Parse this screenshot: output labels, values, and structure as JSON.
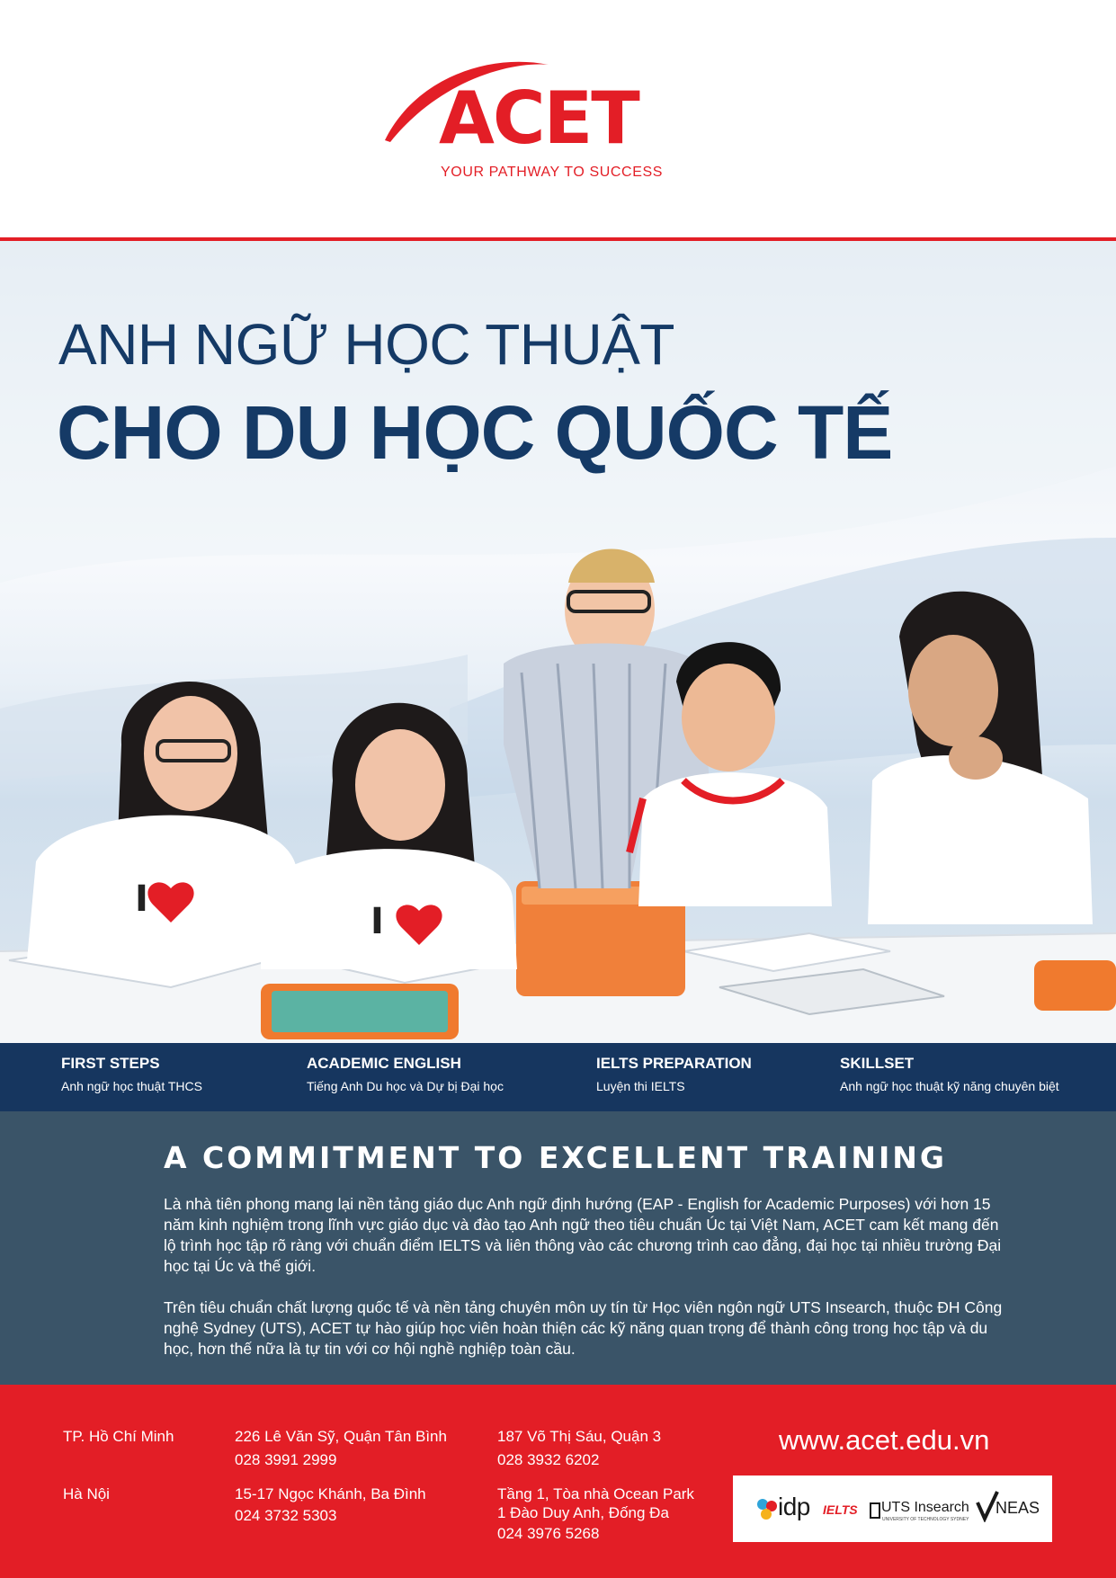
{
  "header": {
    "logo_text": "ACET",
    "tagline": "YOUR PATHWAY TO SUCCESS"
  },
  "hero": {
    "headline_line1": "ANH NGỮ HỌC THUẬT",
    "headline_line2": "CHO DU HỌC QUỐC TẾ"
  },
  "programs": [
    {
      "title": "FIRST STEPS",
      "subtitle": "Anh ngữ học thuật THCS"
    },
    {
      "title": "ACADEMIC ENGLISH",
      "subtitle": "Tiếng Anh Du học và Dự bị Đại học"
    },
    {
      "title": "IELTS PREPARATION",
      "subtitle": "Luyện thi IELTS"
    },
    {
      "title": "SKILLSET",
      "subtitle": "Anh ngữ học thuật kỹ năng chuyên biệt"
    }
  ],
  "commitment": {
    "title": "A COMMITMENT TO EXCELLENT TRAINING",
    "paragraph1": "Là nhà tiên phong mang lại nền tảng giáo dục Anh ngữ định hướng (EAP - English for Academic Purposes) với hơn 15 năm kinh nghiệm trong lĩnh vực giáo dục và đào tạo Anh ngữ theo tiêu chuẩn Úc tại Việt Nam, ACET cam kết mang đến lộ trình học tập rõ ràng với chuẩn điểm IELTS và liên thông vào các chương trình cao đẳng, đại học tại nhiều trường Đại học tại Úc và thế giới.",
    "paragraph2": "Trên tiêu chuẩn chất lượng quốc tế và nền tảng chuyên môn uy tín từ Học viên ngôn ngữ UTS Insearch, thuộc ĐH Công nghệ Sydney (UTS), ACET tự hào giúp học viên hoàn thiện các kỹ năng quan trọng để thành công trong học tập và du học, hơn thế nữa là tự tin với cơ hội nghề nghiệp toàn cầu."
  },
  "footer": {
    "hcm": {
      "city": "TP. Hồ Chí Minh",
      "addr1": "226 Lê Văn Sỹ, Quận Tân Bình",
      "phone1": "028 3991 2999",
      "addr2": "187 Võ Thị Sáu, Quận 3",
      "phone2": "028 3932 6202"
    },
    "hanoi": {
      "city": "Hà Nội",
      "addr1": "15-17 Ngọc Khánh, Ba Đình",
      "phone1": "024 3732 5303",
      "addr2_line1": "Tầng 1, Tòa nhà Ocean Park",
      "addr2_line2": "1 Đào Duy Anh, Đống Đa",
      "phone2": "024 3976 5268"
    },
    "website": "www.acet.edu.vn",
    "partners": {
      "idp": "idp",
      "ielts": "IELTS",
      "uts": "UTS Insearch",
      "uts_sub": "UNIVERSITY OF TECHNOLOGY SYDNEY",
      "neas": "NEAS"
    }
  },
  "colors": {
    "brand_red": "#e31e26",
    "navy": "#153a66",
    "band_navy": "#16365f",
    "slate": "#3a5468"
  }
}
